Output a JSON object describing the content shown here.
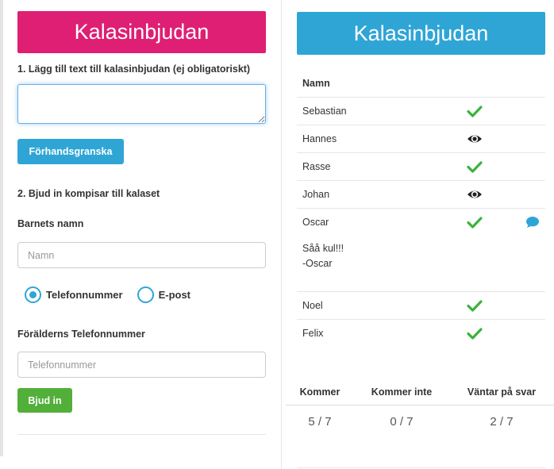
{
  "left": {
    "header": "Kalasinbjudan",
    "step1": "1. Lägg till text till kalasinbjudan (ej obligatoriskt)",
    "textarea_value": "",
    "preview_button": "Förhandsgranska",
    "step2": "2. Bjud in kompisar till kalaset",
    "child_name_label": "Barnets namn",
    "child_name_placeholder": "Namn",
    "radio_phone": "Telefonnummer",
    "radio_email": "E-post",
    "radio_selected": "phone",
    "parent_phone_label": "Förälderns Telefonnummer",
    "parent_phone_placeholder": "Telefonnummer",
    "invite_button": "Bjud in"
  },
  "right": {
    "header": "Kalasinbjudan",
    "table_header": "Namn",
    "guests": [
      {
        "name": "Sebastian",
        "status": "check-icon"
      },
      {
        "name": "Hannes",
        "status": "eye-icon"
      },
      {
        "name": "Rasse",
        "status": "check-icon"
      },
      {
        "name": "Johan",
        "status": "eye-icon"
      },
      {
        "name": "Oscar",
        "status": "check-icon",
        "has_comment": true
      },
      {
        "name": "Noel",
        "status": "check-icon"
      },
      {
        "name": "Felix",
        "status": "check-icon"
      }
    ],
    "comment": {
      "line1": "Såå kul!!!",
      "line2": "-Oscar"
    },
    "summary": {
      "headers": [
        "Kommer",
        "Kommer inte",
        "Väntar på svar"
      ],
      "values": [
        "5 / 7",
        "0 / 7",
        "2 / 7"
      ]
    }
  },
  "colors": {
    "pink": "#de1f74",
    "blue": "#2fa5d6",
    "green": "#52af3a",
    "check": "#3bb33b"
  }
}
